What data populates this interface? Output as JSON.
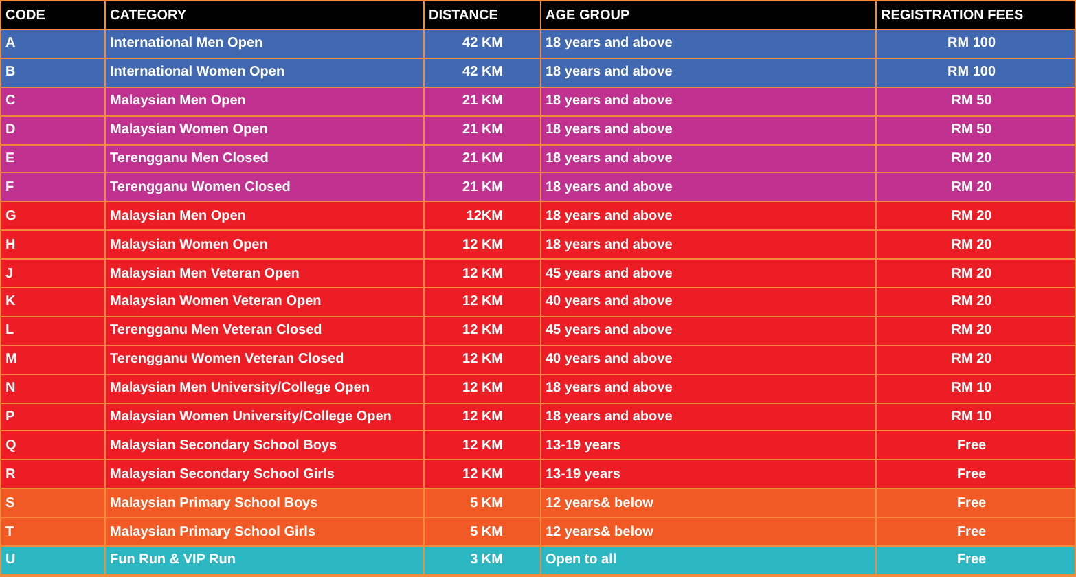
{
  "table": {
    "columns": [
      "CODE",
      "CATEGORY",
      "DISTANCE",
      "AGE GROUP",
      "REGISTRATION FEES"
    ],
    "rows": [
      {
        "color": "#4169b1",
        "cells": [
          "A",
          "International Men Open",
          "42 KM",
          "18 years and above",
          "RM 100"
        ]
      },
      {
        "color": "#4169b1",
        "cells": [
          "B",
          "International Women Open",
          "42 KM",
          "18 years and above",
          "RM 100"
        ]
      },
      {
        "color": "#c1318f",
        "cells": [
          "C",
          "Malaysian Men Open",
          "21 KM",
          "18 years and above",
          "RM 50"
        ]
      },
      {
        "color": "#c1318f",
        "cells": [
          "D",
          "Malaysian Women Open",
          "21 KM",
          "18 years and above",
          "RM 50"
        ]
      },
      {
        "color": "#c1318f",
        "cells": [
          "E",
          "Terengganu Men Closed",
          "21 KM",
          "18 years and above",
          "RM 20"
        ]
      },
      {
        "color": "#c1318f",
        "cells": [
          "F",
          "Terengganu Women Closed",
          "21 KM",
          "18 years and above",
          "RM 20"
        ]
      },
      {
        "color": "#ec1d25",
        "cells": [
          "G",
          "Malaysian Men Open",
          "12KM",
          "18 years and above",
          "RM 20"
        ]
      },
      {
        "color": "#ec1d25",
        "cells": [
          "H",
          "Malaysian Women Open",
          "12 KM",
          "18 years and above",
          "RM 20"
        ]
      },
      {
        "color": "#ec1d25",
        "cells": [
          "J",
          "Malaysian Men Veteran Open",
          "12 KM",
          "45 years and above",
          "RM 20"
        ]
      },
      {
        "color": "#ec1d25",
        "cells": [
          "K",
          "Malaysian Women Veteran Open",
          "12 KM",
          "40 years and above",
          "RM 20"
        ]
      },
      {
        "color": "#ec1d25",
        "cells": [
          "L",
          "Terengganu Men Veteran Closed",
          "12 KM",
          "45 years and above",
          "RM 20"
        ]
      },
      {
        "color": "#ec1d25",
        "cells": [
          "M",
          "Terengganu Women Veteran Closed",
          "12 KM",
          "40 years and above",
          "RM 20"
        ]
      },
      {
        "color": "#ec1d25",
        "cells": [
          "N",
          "Malaysian Men University/College Open",
          "12 KM",
          "18 years and above",
          "RM 10"
        ]
      },
      {
        "color": "#ec1d25",
        "cells": [
          "P",
          "Malaysian Women University/College Open",
          "12 KM",
          "18 years and above",
          "RM 10"
        ]
      },
      {
        "color": "#ec1d25",
        "cells": [
          "Q",
          "Malaysian Secondary School Boys",
          "12 KM",
          "13-19 years",
          "Free"
        ]
      },
      {
        "color": "#ec1d25",
        "cells": [
          "R",
          "Malaysian Secondary School Girls",
          "12 KM",
          "13-19 years",
          "Free"
        ]
      },
      {
        "color": "#f15a24",
        "cells": [
          "S",
          "Malaysian Primary School Boys",
          "5 KM",
          "12 years& below",
          "Free"
        ]
      },
      {
        "color": "#f15a24",
        "cells": [
          "T",
          "Malaysian Primary School Girls",
          "5 KM",
          "12 years& below",
          "Free"
        ]
      },
      {
        "color": "#2cb8c2",
        "cells": [
          "U",
          "Fun Run & VIP Run",
          "3 KM",
          "Open to all",
          "Free"
        ]
      }
    ]
  }
}
